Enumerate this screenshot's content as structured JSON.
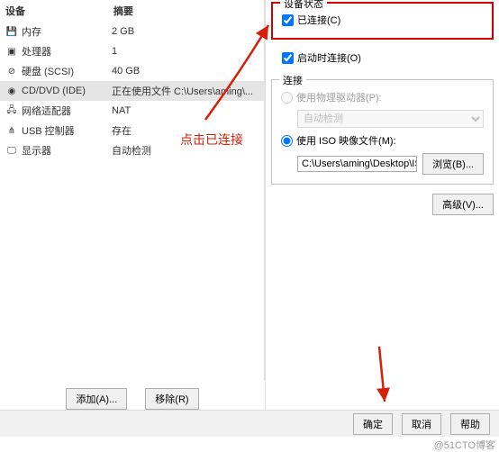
{
  "left": {
    "col_device": "设备",
    "col_summary": "摘要",
    "rows": [
      {
        "icon": "💾",
        "name": "内存",
        "summary": "2 GB"
      },
      {
        "icon": "▣",
        "name": "处理器",
        "summary": "1"
      },
      {
        "icon": "⊘",
        "name": "硬盘 (SCSI)",
        "summary": "40 GB"
      },
      {
        "icon": "◉",
        "name": "CD/DVD (IDE)",
        "summary": "正在使用文件 C:\\Users\\aming\\..."
      },
      {
        "icon": "🖧",
        "name": "网络适配器",
        "summary": "NAT"
      },
      {
        "icon": "⋔",
        "name": "USB 控制器",
        "summary": "存在"
      },
      {
        "icon": "🖵",
        "name": "显示器",
        "summary": "自动检测"
      }
    ],
    "add_btn": "添加(A)...",
    "remove_btn": "移除(R)"
  },
  "right": {
    "status": {
      "title": "设备状态",
      "connected": "已连接(C)",
      "connect_on_power": "启动时连接(O)"
    },
    "connection": {
      "title": "连接",
      "physical": "使用物理驱动器(P):",
      "auto_detect": "自动检测",
      "iso": "使用 ISO 映像文件(M):",
      "iso_path": "C:\\Users\\aming\\Desktop\\ISO",
      "browse": "浏览(B)..."
    },
    "advanced_btn": "高级(V)..."
  },
  "footer": {
    "ok": "确定",
    "cancel": "取消",
    "help": "帮助"
  },
  "annotation": {
    "text": "点击已连接"
  },
  "watermark": "@51CTO博客"
}
